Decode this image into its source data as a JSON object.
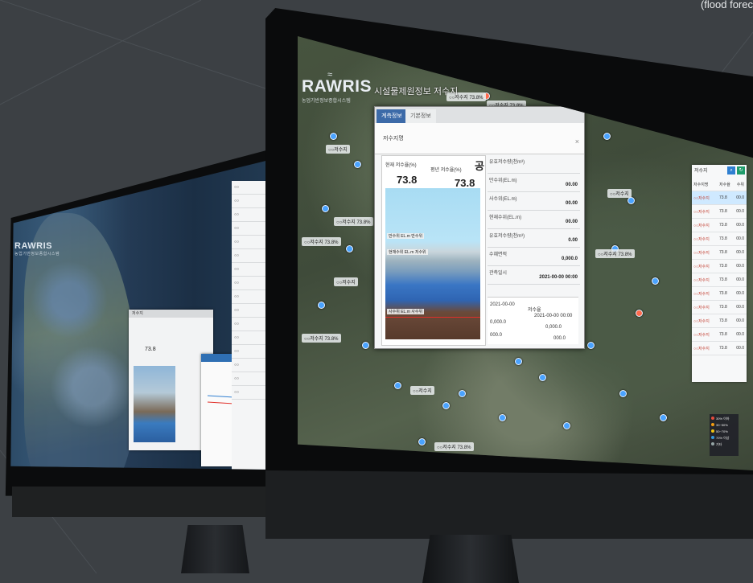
{
  "corner_text": "(flood forec",
  "front": {
    "logo": {
      "word": "RAWRIS",
      "sub": "농업기반정보종합시스템"
    },
    "title": "시설물제원정보 저수지",
    "popup": {
      "tabs": [
        "계측정보",
        "기본정보"
      ],
      "subtitle": "저수지명",
      "left_label_a": "현재 저수율(%)",
      "left_label_b": "평년 저수율(%)",
      "value_a": "73.8",
      "value_b": "73.8",
      "marker": "공",
      "levels": [
        "만수위 EL.m 만수위",
        "현재수위 EL.m 저수위",
        "사수위 EL.m 사수위"
      ],
      "rows": [
        {
          "k": "유효저수량(천m³)",
          "v": ""
        },
        {
          "k": "만수위(EL.m)",
          "v": "00.00"
        },
        {
          "k": "사수위(EL.m)",
          "v": "00.00"
        },
        {
          "k": "현재수위(EL.m)",
          "v": "00.00"
        },
        {
          "k": "유효저수량(천m³)",
          "v": "0.00"
        },
        {
          "k": "수혜면적",
          "v": "0,000.0"
        },
        {
          "k": "관측일시",
          "v": "2021-00-00 00:00"
        }
      ],
      "box": {
        "date_a": "2021-00-00",
        "label_mid": "저수율",
        "date_b": "2021-00-00 00:00",
        "val_a": "0,000.0",
        "val_b": "0,000.0",
        "val_c": "000.0",
        "val_d": "000.0"
      }
    },
    "side": {
      "title": "저수지",
      "rows": [
        {
          "n": "저수지명",
          "a": "저수율",
          "b": "수위"
        },
        {
          "n": "○○저수지",
          "a": "73.8",
          "b": "00.0"
        },
        {
          "n": "○○저수지",
          "a": "73.8",
          "b": "00.0"
        },
        {
          "n": "○○저수지",
          "a": "73.8",
          "b": "00.0"
        },
        {
          "n": "○○저수지",
          "a": "73.8",
          "b": "00.0"
        },
        {
          "n": "○○저수지",
          "a": "73.8",
          "b": "00.0"
        },
        {
          "n": "○○저수지",
          "a": "73.8",
          "b": "00.0"
        },
        {
          "n": "○○저수지",
          "a": "73.8",
          "b": "00.0"
        },
        {
          "n": "○○저수지",
          "a": "73.8",
          "b": "00.0"
        },
        {
          "n": "○○저수지",
          "a": "73.8",
          "b": "00.0"
        },
        {
          "n": "○○저수지",
          "a": "73.8",
          "b": "00.0"
        },
        {
          "n": "○○저수지",
          "a": "73.8",
          "b": "00.0"
        },
        {
          "n": "○○저수지",
          "a": "73.8",
          "b": "00.0"
        }
      ]
    },
    "map_tags": [
      "○○저수지 73.8%",
      "○○저수지 73.8%",
      "○○저수지",
      "○○저수지 73.8%",
      "○○저수지 73.8%",
      "○○저수지",
      "○○저수지 73.8%",
      "○○저수지",
      "○○저수지 73.8%",
      "○○저수지",
      "○○저수지 73.8%"
    ],
    "legend": [
      "30% 이하",
      "30~50%",
      "50~70%",
      "70% 이상",
      "기타"
    ],
    "legend_colors": [
      "#e74c3c",
      "#f39c12",
      "#f1c40f",
      "#3498db",
      "#95a5a6"
    ]
  },
  "back": {
    "logo": "RAWRIS",
    "logo_sub": "농업기반정보종합시스템",
    "panel_title": "저수지",
    "value": "73.8",
    "side_rows": [
      "○○",
      "○○",
      "○○",
      "○○",
      "○○",
      "○○",
      "○○",
      "○○",
      "○○",
      "○○",
      "○○",
      "○○",
      "○○",
      "○○",
      "○○",
      "○○"
    ]
  },
  "colors": {
    "background": "#3c4044",
    "accent": "#3c6aa8",
    "water": "#2f65b3",
    "alert": "#e0302a"
  }
}
